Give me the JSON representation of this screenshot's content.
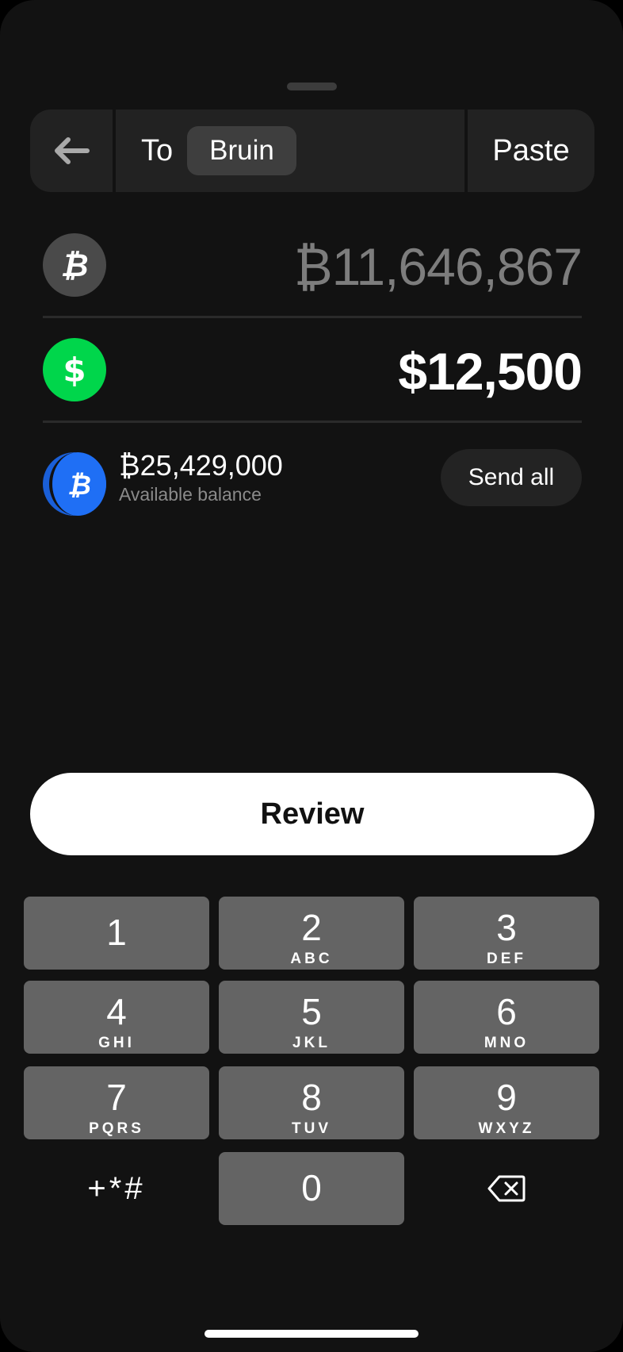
{
  "header": {
    "to_label": "To",
    "recipient": "Bruin",
    "paste_label": "Paste"
  },
  "amounts": {
    "btc_amount": "₿11,646,867",
    "usd_amount": "$12,500"
  },
  "balance": {
    "amount": "₿25,429,000",
    "label": "Available balance",
    "send_all_label": "Send all"
  },
  "review_label": "Review",
  "keypad": {
    "keys": [
      {
        "digit": "1",
        "letters": ""
      },
      {
        "digit": "2",
        "letters": "ABC"
      },
      {
        "digit": "3",
        "letters": "DEF"
      },
      {
        "digit": "4",
        "letters": "GHI"
      },
      {
        "digit": "5",
        "letters": "JKL"
      },
      {
        "digit": "6",
        "letters": "MNO"
      },
      {
        "digit": "7",
        "letters": "PQRS"
      },
      {
        "digit": "8",
        "letters": "TUV"
      },
      {
        "digit": "9",
        "letters": "WXYZ"
      },
      {
        "digit": "0",
        "letters": ""
      }
    ],
    "symbols": "+*#"
  },
  "colors": {
    "background": "#121212",
    "usd_green": "#00d64b",
    "btc_blue": "#1f6ff5",
    "key_gray": "#646464"
  },
  "icons": [
    "back-arrow-icon",
    "bitcoin-icon",
    "dollar-icon",
    "backspace-icon"
  ]
}
